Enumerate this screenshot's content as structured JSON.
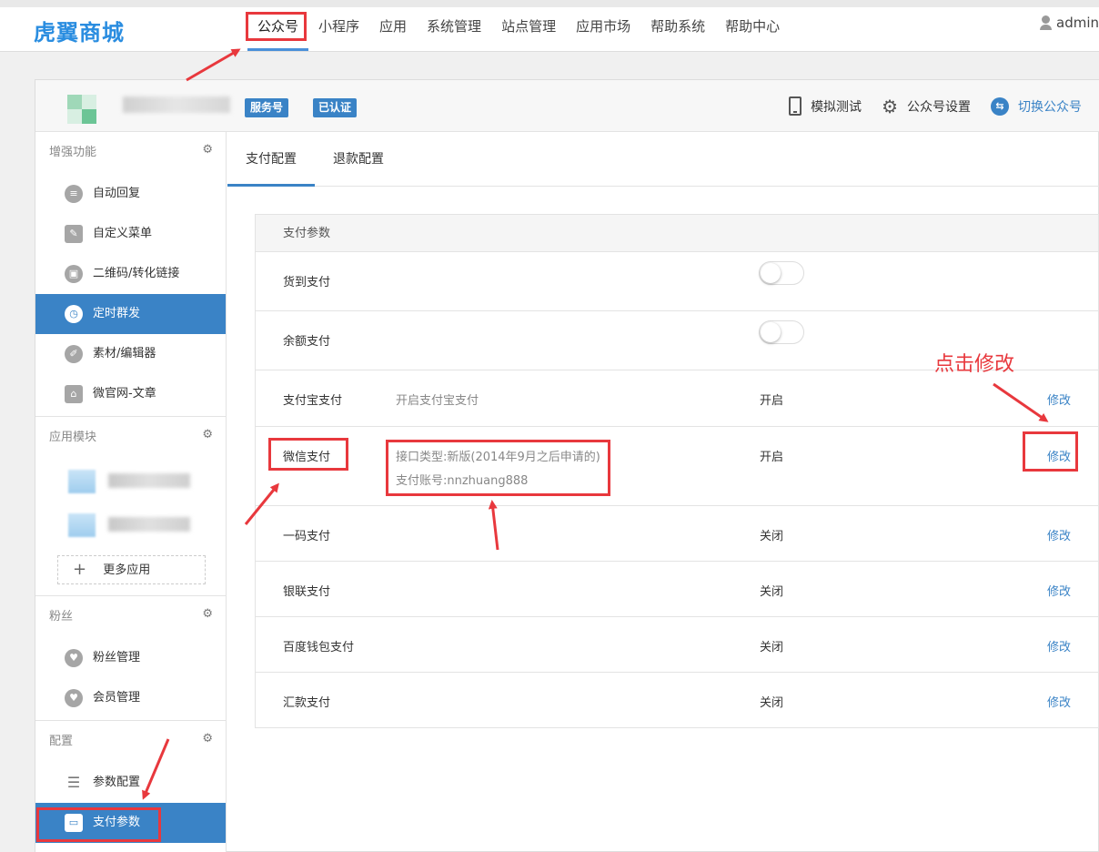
{
  "topnav": {
    "logo": "虎翼商城",
    "items": [
      "公众号",
      "小程序",
      "应用",
      "系统管理",
      "站点管理",
      "应用市场",
      "帮助系统",
      "帮助中心"
    ],
    "user": "admin"
  },
  "account": {
    "badge_type": "服务号",
    "badge_verified": "已认证",
    "actions": {
      "simulate": "模拟测试",
      "settings": "公众号设置",
      "switch": "切换公众号"
    }
  },
  "sidebar": {
    "group1": {
      "title": "增强功能",
      "items": [
        {
          "label": "自动回复",
          "icon": "chat-icon"
        },
        {
          "label": "自定义菜单",
          "icon": "document-icon"
        },
        {
          "label": "二维码/转化链接",
          "icon": "qrcode-icon"
        },
        {
          "label": "定时群发",
          "icon": "clock-icon"
        },
        {
          "label": "素材/编辑器",
          "icon": "pencil-icon"
        },
        {
          "label": "微官网-文章",
          "icon": "home-icon"
        }
      ]
    },
    "group2": {
      "title": "应用模块",
      "more": "更多应用"
    },
    "group3": {
      "title": "粉丝",
      "items": [
        {
          "label": "粉丝管理",
          "icon": "heart-icon"
        },
        {
          "label": "会员管理",
          "icon": "heart-icon"
        }
      ]
    },
    "group4": {
      "title": "配置",
      "items": [
        {
          "label": "参数配置",
          "icon": "list-icon"
        },
        {
          "label": "支付参数",
          "icon": "wallet-icon"
        }
      ]
    }
  },
  "tabs": [
    "支付配置",
    "退款配置"
  ],
  "payment": {
    "header": "支付参数",
    "rows": [
      {
        "name": "货到支付",
        "toggle": false
      },
      {
        "name": "余额支付",
        "toggle": false
      },
      {
        "name": "支付宝支付",
        "desc": "开启支付宝支付",
        "status": "开启",
        "edit": "修改"
      },
      {
        "name": "微信支付",
        "desc1": "接口类型:新版(2014年9月之后申请的)",
        "desc2": "支付账号:nnzhuang888",
        "status": "开启",
        "edit": "修改"
      },
      {
        "name": "一码支付",
        "status": "关闭",
        "edit": "修改"
      },
      {
        "name": "银联支付",
        "status": "关闭",
        "edit": "修改"
      },
      {
        "name": "百度钱包支付",
        "status": "关闭",
        "edit": "修改"
      },
      {
        "name": "汇款支付",
        "status": "关闭",
        "edit": "修改"
      }
    ]
  },
  "annotation": {
    "text": "点击修改",
    "color": "#e8383d"
  },
  "colors": {
    "accent": "#3a83c6",
    "highlight": "#e8383d"
  }
}
